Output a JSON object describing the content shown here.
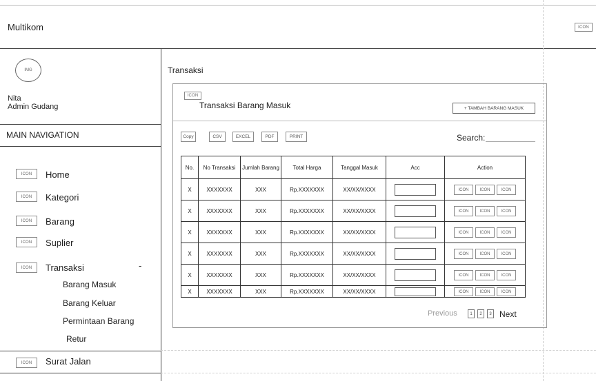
{
  "header": {
    "brand": "Multikom",
    "corner_icon": "ICON"
  },
  "profile": {
    "avatar_label": "IMG",
    "name": "Nita",
    "role": "Admin Gudang"
  },
  "nav": {
    "heading": "MAIN NAVIGATION",
    "icon_label": "ICON",
    "items": [
      {
        "label": "Home"
      },
      {
        "label": "Kategori"
      },
      {
        "label": "Barang"
      },
      {
        "label": "Suplier"
      },
      {
        "label": "Transaksi",
        "expanded_marker": "-"
      },
      {
        "label": "Surat Jalan"
      }
    ],
    "transaksi_sub": [
      "Barang Masuk",
      "Barang Keluar",
      "Permintaan Barang",
      "Retur"
    ]
  },
  "main": {
    "page_title": "Transaksi",
    "card": {
      "icon_label": "ICON",
      "title": "Transaksi Barang Masuk",
      "add_button": "+ TAMBAH BARANG MASUK",
      "export_buttons": [
        "Copy",
        "CSV",
        "EXCEL",
        "PDF",
        "PRINT"
      ],
      "search_label": "Search:",
      "table": {
        "headers": [
          "No.",
          "No Transaksi",
          "Jumlah Barang",
          "Total Harga",
          "Tanggal Masuk",
          "Acc",
          "Action"
        ],
        "rows": [
          [
            "X",
            "XXXXXXX",
            "XXX",
            "Rp.XXXXXXX",
            "XX/XX/XXXX"
          ],
          [
            "X",
            "XXXXXXX",
            "XXX",
            "Rp.XXXXXXX",
            "XX/XX/XXXX"
          ],
          [
            "X",
            "XXXXXXX",
            "XXX",
            "Rp.XXXXXXX",
            "XX/XX/XXXX"
          ],
          [
            "X",
            "XXXXXXX",
            "XXX",
            "Rp.XXXXXXX",
            "XX/XX/XXXX"
          ],
          [
            "X",
            "XXXXXXX",
            "XXX",
            "Rp.XXXXXXX",
            "XX/XX/XXXX"
          ],
          [
            "X",
            "XXXXXXX",
            "XXX",
            "Rp.XXXXXXX",
            "XX/XX/XXXX"
          ]
        ],
        "action_icon_label": "ICON"
      },
      "pagination": {
        "previous": "Previous",
        "pages": [
          "1",
          "2",
          "3"
        ],
        "next": "Next"
      }
    }
  }
}
